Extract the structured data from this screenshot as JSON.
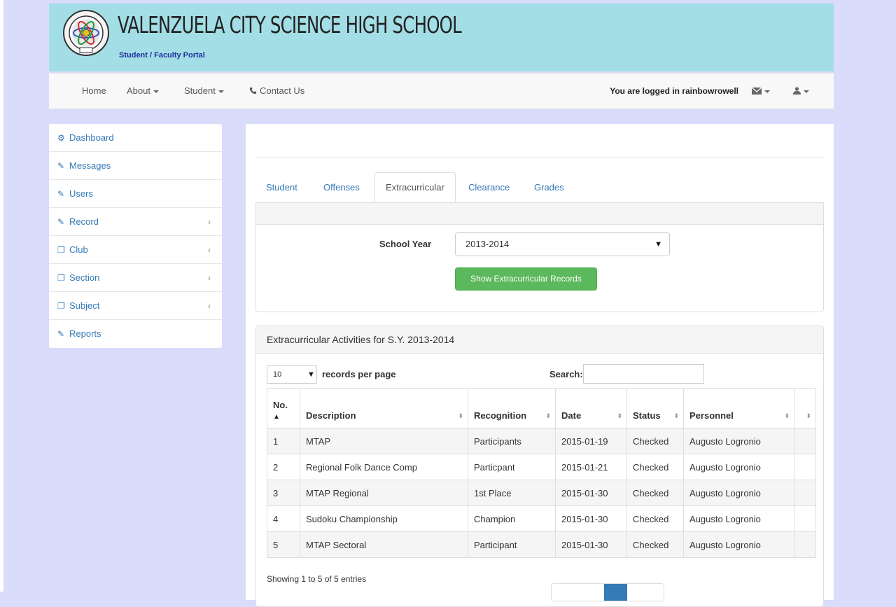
{
  "header": {
    "school_name": "VALENZUELA CITY SCIENCE HIGH SCHOOL",
    "portal_subtitle": "Student / Faculty Portal"
  },
  "navbar": {
    "home": "Home",
    "about": "About",
    "student": "Student",
    "contact": "Contact Us",
    "logged_in": "You are logged in rainbowrowell"
  },
  "sidebar": {
    "items": [
      {
        "label": "Dashboard",
        "icon": "dashboard-icon"
      },
      {
        "label": "Messages",
        "icon": "edit-icon"
      },
      {
        "label": "Users",
        "icon": "edit-icon"
      },
      {
        "label": "Record",
        "icon": "edit-icon",
        "has_children": true
      },
      {
        "label": "Club",
        "icon": "copy-icon",
        "has_children": true
      },
      {
        "label": "Section",
        "icon": "copy-icon",
        "has_children": true
      },
      {
        "label": "Subject",
        "icon": "copy-icon",
        "has_children": true
      },
      {
        "label": "Reports",
        "icon": "edit-icon"
      }
    ]
  },
  "tabs": [
    {
      "label": "Student"
    },
    {
      "label": "Offenses"
    },
    {
      "label": "Extracurricular",
      "active": true
    },
    {
      "label": "Clearance"
    },
    {
      "label": "Grades"
    }
  ],
  "filter": {
    "school_year_label": "School Year",
    "school_year_value": "2013-2014",
    "button_label": "Show Extracurricular Records"
  },
  "records": {
    "panel_title": "Extracurricular Activities for S.Y. 2013-2014",
    "page_length": "10",
    "records_per_page_label": "records per page",
    "search_label": "Search:",
    "search_value": "",
    "columns": [
      "No.",
      "Description",
      "Recognition",
      "Date",
      "Status",
      "Personnel",
      ""
    ],
    "rows": [
      [
        "1",
        "MTAP",
        "Participants",
        "2015-01-19",
        "Checked",
        "Augusto Logronio",
        ""
      ],
      [
        "2",
        "Regional Folk Dance Comp",
        "Particpant",
        "2015-01-21",
        "Checked",
        "Augusto Logronio",
        ""
      ],
      [
        "3",
        "MTAP Regional",
        "1st Place",
        "2015-01-30",
        "Checked",
        "Augusto Logronio",
        ""
      ],
      [
        "4",
        "Sudoku Championship",
        "Champion",
        "2015-01-30",
        "Checked",
        "Augusto Logronio",
        ""
      ],
      [
        "5",
        "MTAP Sectoral",
        "Participant",
        "2015-01-30",
        "Checked",
        "Augusto Logronio",
        ""
      ]
    ],
    "showing_text": "Showing 1 to 5 of 5 entries"
  },
  "colors": {
    "banner": "#a3dee6",
    "page_bg": "#d9dcfa",
    "link": "#337ab7",
    "success_button": "#5cb85c",
    "portal_subtitle": "#1f2f9c"
  }
}
